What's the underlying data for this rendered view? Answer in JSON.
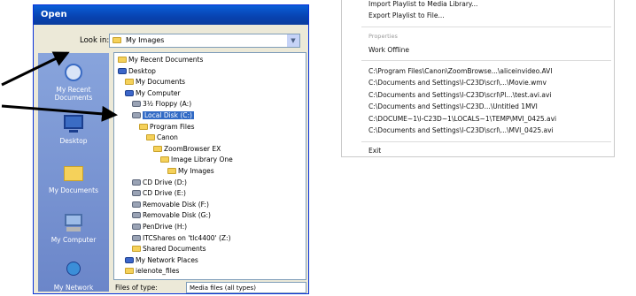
{
  "dialog": {
    "title": "Open",
    "lookin_label": "Look in:",
    "lookin_value": "My Images",
    "places": [
      "My Recent Documents",
      "Desktop",
      "My Documents",
      "My Computer",
      "My Network"
    ],
    "tree": [
      {
        "label": "My Recent Documents",
        "indent": 0,
        "icon": "folder"
      },
      {
        "label": "Desktop",
        "indent": 0,
        "icon": "desktop"
      },
      {
        "label": "My Documents",
        "indent": 1,
        "icon": "folder"
      },
      {
        "label": "My Computer",
        "indent": 1,
        "icon": "computer"
      },
      {
        "label": "3½ Floppy (A:)",
        "indent": 2,
        "icon": "drive"
      },
      {
        "label": "Local Disk (C:)",
        "indent": 2,
        "icon": "drive",
        "selected": true
      },
      {
        "label": "Program Files",
        "indent": 3,
        "icon": "folder"
      },
      {
        "label": "Canon",
        "indent": 4,
        "icon": "folder"
      },
      {
        "label": "ZoomBrowser EX",
        "indent": 5,
        "icon": "folder"
      },
      {
        "label": "Image Library One",
        "indent": 6,
        "icon": "folder"
      },
      {
        "label": "My Images",
        "indent": 7,
        "icon": "folder"
      },
      {
        "label": "CD Drive (D:)",
        "indent": 2,
        "icon": "drive"
      },
      {
        "label": "CD Drive (E:)",
        "indent": 2,
        "icon": "drive"
      },
      {
        "label": "Removable Disk (F:)",
        "indent": 2,
        "icon": "drive"
      },
      {
        "label": "Removable Disk (G:)",
        "indent": 2,
        "icon": "drive"
      },
      {
        "label": "PenDrive (H:)",
        "indent": 2,
        "icon": "drive"
      },
      {
        "label": "ITCShares on 'tlc4400' (Z:)",
        "indent": 2,
        "icon": "drive"
      },
      {
        "label": "Shared Documents",
        "indent": 2,
        "icon": "folder"
      },
      {
        "label": "My Network Places",
        "indent": 1,
        "icon": "network"
      },
      {
        "label": "ielenote_files",
        "indent": 1,
        "icon": "folder"
      }
    ],
    "filetype_label": "Files of type:",
    "filetype_value": "Media files (all types)"
  },
  "menu": {
    "items_top": [
      "Import Playlist to Media Library...",
      "Export Playlist to File..."
    ],
    "section_label": "Properties",
    "work_offline": "Work Offline",
    "recent_files": [
      "C:\\Program Files\\Canon\\ZoomBrowse...\\aliceinvideo.AVI",
      "C:\\Documents and Settings\\l-C23D\\scrl\\...\\Movie.wmv",
      "C:\\Documents and Settings\\l-C23D\\scrl\\Pl...\\test.avi.avi",
      "C:\\Documents and Settings\\l-C23D...\\Untitled 1MVI",
      "C:\\DOCUME~1\\l-C23D~1\\LOCALS~1\\TEMP\\MVI_0425.avi",
      "C:\\Documents and Settings\\l-C23D\\scrl\\...\\MVI_0425.avi"
    ],
    "exit": "Exit"
  },
  "colors": {
    "titlebar": "#0a5fd8",
    "places_bar": "#6b86c9",
    "selection": "#316ac5"
  }
}
